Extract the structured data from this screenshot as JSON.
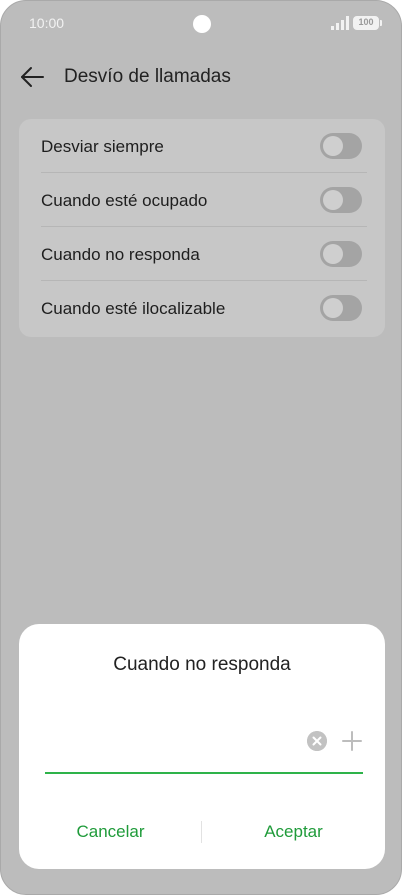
{
  "status_bar": {
    "time": "10:00",
    "battery": "100",
    "icons": [
      "signal-icon",
      "battery-icon"
    ]
  },
  "header": {
    "title": "Desvío de llamadas",
    "back_icon": "arrow-left-icon"
  },
  "settings": {
    "items": [
      {
        "label": "Desviar siempre",
        "enabled": false
      },
      {
        "label": "Cuando esté ocupado",
        "enabled": false
      },
      {
        "label": "Cuando no responda",
        "enabled": false
      },
      {
        "label": "Cuando esté ilocalizable",
        "enabled": false
      }
    ]
  },
  "dialog": {
    "title": "Cuando no responda",
    "input_value": "",
    "clear_icon": "clear-circle-icon",
    "add_icon": "plus-icon",
    "cancel_label": "Cancelar",
    "accept_label": "Aceptar"
  },
  "colors": {
    "accent": "#1f9b3a",
    "underline": "#2eb34a",
    "scrim_background": "#bcbcbc",
    "card_background": "#c7c7c7",
    "toggle_off": "#a4a4a4"
  }
}
